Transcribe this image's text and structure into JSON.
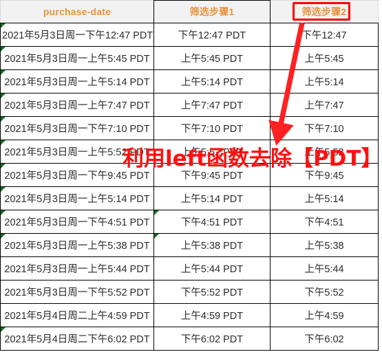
{
  "table": {
    "headers": [
      {
        "label": "purchase-date",
        "highlighted": false
      },
      {
        "label": "筛选步骤1",
        "highlighted": false
      },
      {
        "label": "",
        "highlighted": false
      },
      {
        "label": "筛选步骤2",
        "highlighted": true
      }
    ],
    "rows": [
      {
        "purchase_date": "2021年5月3日周一下午12:47 PDT",
        "step1": "下午12:47 PDT",
        "step2": "下午12:47",
        "marker_col1": true,
        "marker_col2": false
      },
      {
        "purchase_date": "2021年5月3日周一上午5:45 PDT",
        "step1": "上午5:45 PDT",
        "step2": "上午5:45",
        "marker_col1": true,
        "marker_col2": false
      },
      {
        "purchase_date": "2021年5月3日周一上午5:14 PDT",
        "step1": "上午5:14 PDT",
        "step2": "上午5:14",
        "marker_col1": true,
        "marker_col2": false
      },
      {
        "purchase_date": "2021年5月3日周一上午7:47 PDT",
        "step1": "上午7:47 PDT",
        "step2": "上午7:47",
        "marker_col1": true,
        "marker_col2": false
      },
      {
        "purchase_date": "2021年5月3日周一下午7:10 PDT",
        "step1": "下午7:10 PDT",
        "step2": "下午7:10",
        "marker_col1": true,
        "marker_col2": false
      },
      {
        "purchase_date": "2021年5月3日周一上午5:52 PDT",
        "step1": "上午5:52 PDT",
        "step2": "上午5:52",
        "marker_col1": true,
        "marker_col2": false
      },
      {
        "purchase_date": "2021年5月3日周一下午9:45 PDT",
        "step1": "下午9:45 PDT",
        "step2": "下午9:45",
        "marker_col1": true,
        "marker_col2": false
      },
      {
        "purchase_date": "2021年5月3日周一上午5:14 PDT",
        "step1": "上午5:14 PDT",
        "step2": "上午5:14",
        "marker_col1": true,
        "marker_col2": false
      },
      {
        "purchase_date": "2021年5月3日周一下午4:51 PDT",
        "step1": "下午4:51 PDT",
        "step2": "下午4:51",
        "marker_col1": true,
        "marker_col2": true
      },
      {
        "purchase_date": "2021年5月3日周一上午5:38 PDT",
        "step1": "上午5:38 PDT",
        "step2": "上午5:38",
        "marker_col1": true,
        "marker_col2": true
      },
      {
        "purchase_date": "2021年5月3日周一上午5:44 PDT",
        "step1": "上午5:44 PDT",
        "step2": "上午5:44",
        "marker_col1": false,
        "marker_col2": false
      },
      {
        "purchase_date": "2021年5月3日周一下午5:52 PDT",
        "step1": "下午5:52 PDT",
        "step2": "下午5:52",
        "marker_col1": false,
        "marker_col2": false
      },
      {
        "purchase_date": "2021年5月4日周二上午4:59 PDT",
        "step1": "上午4:59 PDT",
        "step2": "上午4:59",
        "marker_col1": false,
        "marker_col2": false
      },
      {
        "purchase_date": "2021年5月4日周二下午6:02 PDT",
        "step1": "下午6:02 PDT",
        "step2": "下午6:02",
        "marker_col1": true,
        "marker_col2": false
      }
    ]
  },
  "annotation": {
    "text": "利用left函数去除【PDT】",
    "color": "#ff1010"
  },
  "highlight": {
    "box_color": "#ff0000",
    "arrow_color": "#ff2020"
  },
  "colors": {
    "header_text": "#e8923c",
    "header_bg": "#f2f2f2",
    "cell_text": "#2b2b2b",
    "grid": "#000000",
    "error_marker": "#17702a"
  }
}
